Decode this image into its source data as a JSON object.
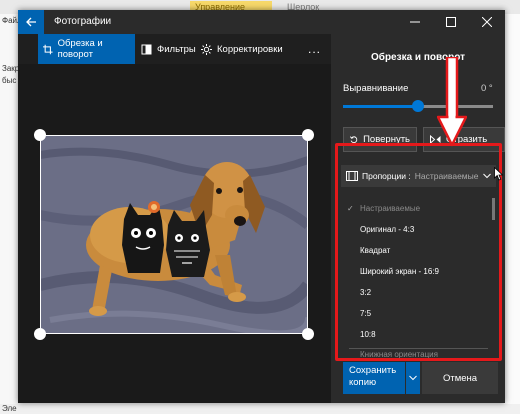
{
  "background": {
    "tab_manage": "Управление",
    "tab_sherlock": "Шерлок",
    "left_labels": [
      "Файл",
      "Закр",
      "быс"
    ],
    "bottom_label": "Эле"
  },
  "window": {
    "title": "Фотографии",
    "controls": {
      "minimize": "minimize-icon",
      "maximize": "maximize-icon",
      "close": "close-icon"
    }
  },
  "toolbar": {
    "crop_rotate": "Обрезка и поворот",
    "filters": "Фильтры",
    "adjustments": "Корректировки",
    "more": "..."
  },
  "panel": {
    "title": "Обрезка и поворот",
    "alignment_label": "Выравнивание",
    "alignment_value": "0 °",
    "alignment_level": 0.5,
    "rotate_label": "Повернуть",
    "flip_label": "Отразить",
    "proportions_label": "Пропорции :",
    "proportions_value": "Настраиваемые"
  },
  "dropdown": {
    "selected": "Настраиваемые",
    "items": [
      {
        "label": "Настраиваемые",
        "checked": true,
        "dimmed": true
      },
      {
        "label": "Оригинал - 4:3"
      },
      {
        "label": "Квадрат"
      },
      {
        "label": "Широкий экран - 16:9"
      },
      {
        "label": "3:2"
      },
      {
        "label": "7:5"
      },
      {
        "label": "10:8"
      }
    ],
    "orientation_label": "Книжная ориентация"
  },
  "footer": {
    "save_copy": "Сохранить копию",
    "cancel": "Отмена"
  },
  "colors": {
    "accent": "#0063b1",
    "highlight": "#e5191b",
    "window_bg": "#1f1f1f",
    "panel_bg": "#2b2b2b"
  }
}
